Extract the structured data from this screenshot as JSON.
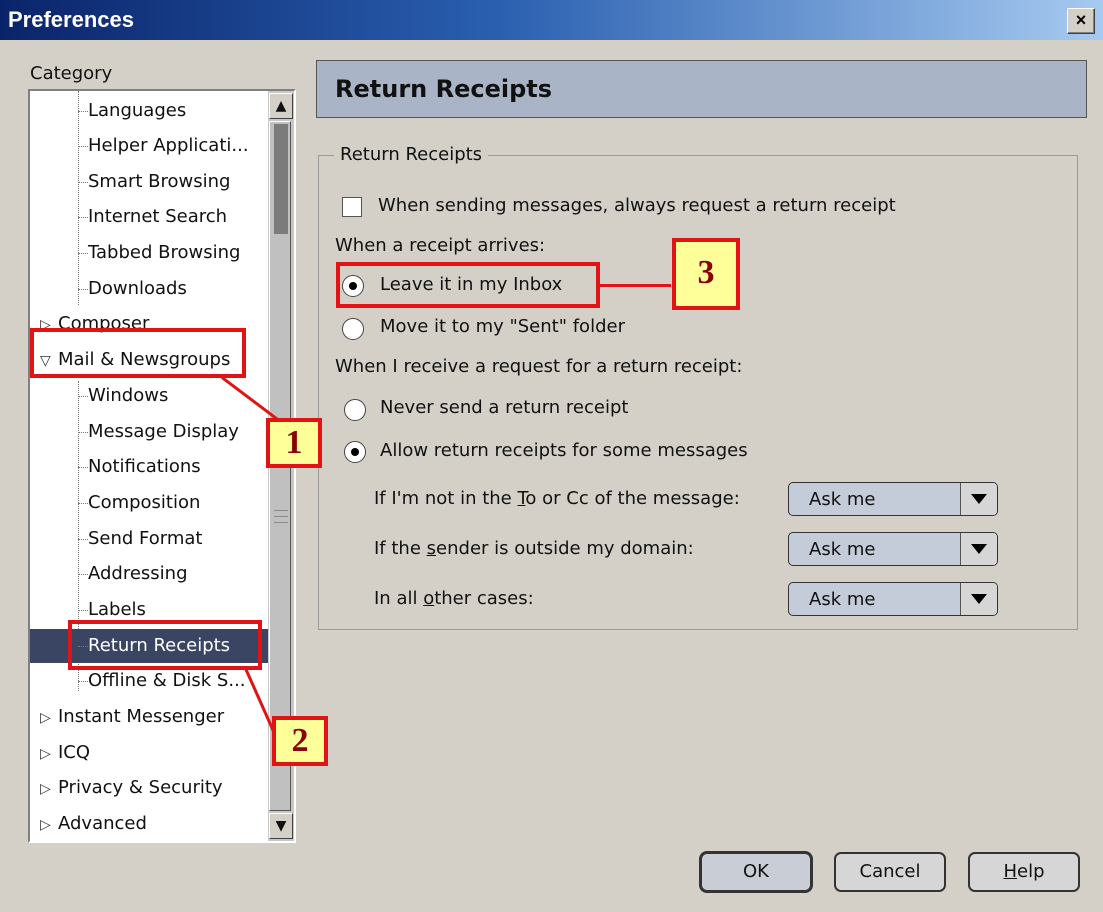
{
  "window": {
    "title": "Preferences",
    "close_label": "×"
  },
  "sidebar": {
    "label": "Category",
    "items": [
      {
        "label": "Languages"
      },
      {
        "label": "Helper Applicati..."
      },
      {
        "label": "Smart Browsing"
      },
      {
        "label": "Internet Search"
      },
      {
        "label": "Tabbed Browsing"
      },
      {
        "label": "Downloads"
      },
      {
        "label": "Composer"
      },
      {
        "label": "Mail & Newsgroups"
      },
      {
        "label": "Windows"
      },
      {
        "label": "Message Display"
      },
      {
        "label": "Notifications"
      },
      {
        "label": "Composition"
      },
      {
        "label": "Send Format"
      },
      {
        "label": "Addressing"
      },
      {
        "label": "Labels"
      },
      {
        "label": "Return Receipts"
      },
      {
        "label": "Offline & Disk S..."
      },
      {
        "label": "Instant Messenger"
      },
      {
        "label": "ICQ"
      },
      {
        "label": "Privacy & Security"
      },
      {
        "label": "Advanced"
      }
    ],
    "selected": "Return Receipts"
  },
  "panel": {
    "title": "Return Receipts",
    "group_label": "Return Receipts",
    "always_request": {
      "label": "When sending messages, always request a return receipt",
      "checked": false
    },
    "arrives_heading": "When a receipt arrives:",
    "arrives_options": [
      {
        "label": "Leave it in my Inbox",
        "selected": true
      },
      {
        "label": "Move it to my \"Sent\" folder",
        "selected": false
      }
    ],
    "request_heading": "When I receive a request for a return receipt:",
    "request_options": [
      {
        "label": "Never send a return receipt",
        "selected": false
      },
      {
        "label": "Allow return receipts for some messages",
        "selected": true
      }
    ],
    "conditions": [
      {
        "pre": "If I'm not in the ",
        "key": "T",
        "post": "o or Cc of the message:",
        "value": "Ask me"
      },
      {
        "pre": "If the ",
        "key": "s",
        "post": "ender is outside my domain:",
        "value": "Ask me"
      },
      {
        "pre": "In all ",
        "key": "o",
        "post": "ther cases:",
        "value": "Ask me"
      }
    ]
  },
  "buttons": {
    "ok": "OK",
    "cancel": "Cancel",
    "help_key": "H",
    "help_rest": "elp"
  },
  "annotations": [
    "1",
    "2",
    "3"
  ],
  "colors": {
    "annotation": "#e01414",
    "badge_fill": "#ffff9a",
    "selection": "#394563"
  }
}
